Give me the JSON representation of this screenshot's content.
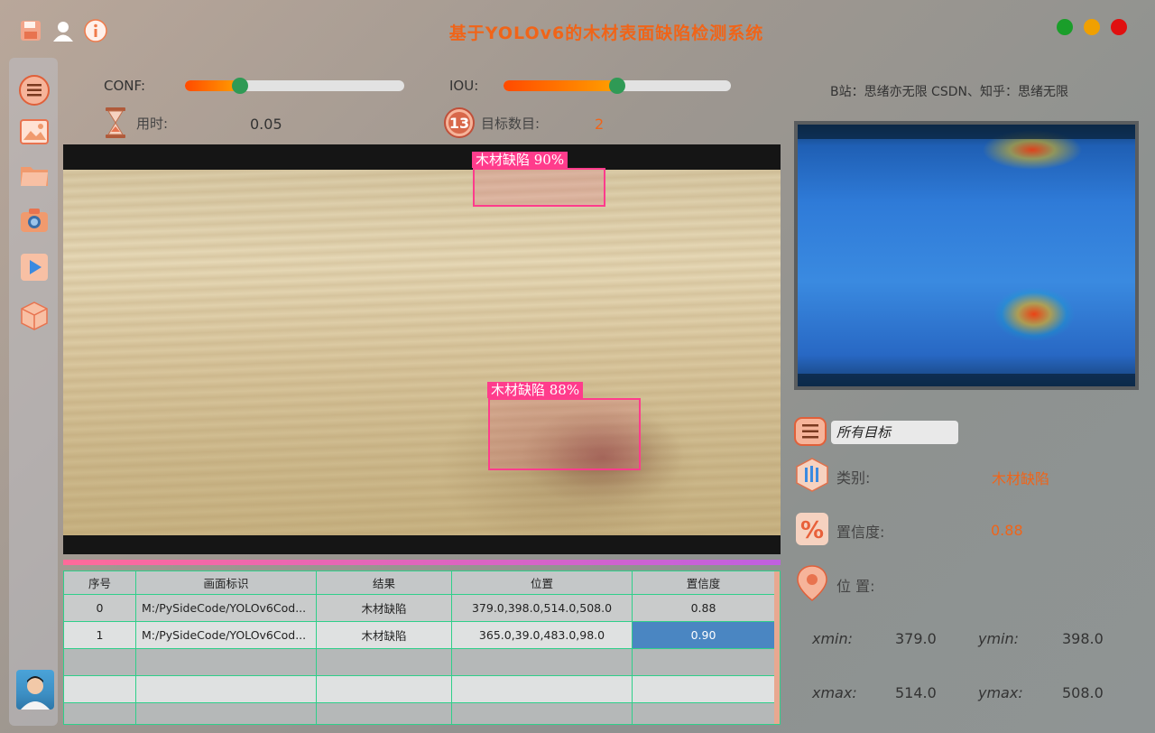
{
  "app": {
    "title": "基于YOLOv6的木材表面缺陷检测系统",
    "credit": "B站：思绪亦无限  CSDN、知乎：思绪无限"
  },
  "window_controls": {
    "colors": [
      "#1a9e2a",
      "#f0a000",
      "#e01010"
    ]
  },
  "toolbar_icons": [
    "save-icon",
    "user-icon",
    "info-icon"
  ],
  "sidebar_icons": [
    "menu-icon",
    "image-icon",
    "folder-icon",
    "camera-icon",
    "video-play-icon",
    "model-cube-icon"
  ],
  "params": {
    "conf_label": "CONF:",
    "conf_value": 0.25,
    "iou_label": "IOU:",
    "iou_value": 0.5,
    "time_label": "用时:",
    "time_value": "0.05",
    "count_label": "目标数目:",
    "count_value": "2"
  },
  "detections": [
    {
      "label": "木材缺陷  90%"
    },
    {
      "label": "木材缺陷  88%"
    }
  ],
  "table": {
    "headers": [
      "序号",
      "画面标识",
      "结果",
      "位置",
      "置信度"
    ],
    "rows": [
      [
        "0",
        "M:/PySideCode/YOLOv6Cod...",
        "木材缺陷",
        "379.0,398.0,514.0,508.0",
        "0.88"
      ],
      [
        "1",
        "M:/PySideCode/YOLOv6Cod...",
        "木材缺陷",
        "365.0,39.0,483.0,98.0",
        "0.90"
      ]
    ]
  },
  "target_select": {
    "value": "所有目标"
  },
  "result": {
    "class_label": "类别:",
    "class_value": "木材缺陷",
    "conf_label": "置信度:",
    "conf_value": "0.88",
    "pos_label": "位 置:",
    "xmin_label": "xmin:",
    "xmin_value": "379.0",
    "ymin_label": "ymin:",
    "ymin_value": "398.0",
    "xmax_label": "xmax:",
    "xmax_value": "514.0",
    "ymax_label": "ymax:",
    "ymax_value": "508.0"
  }
}
